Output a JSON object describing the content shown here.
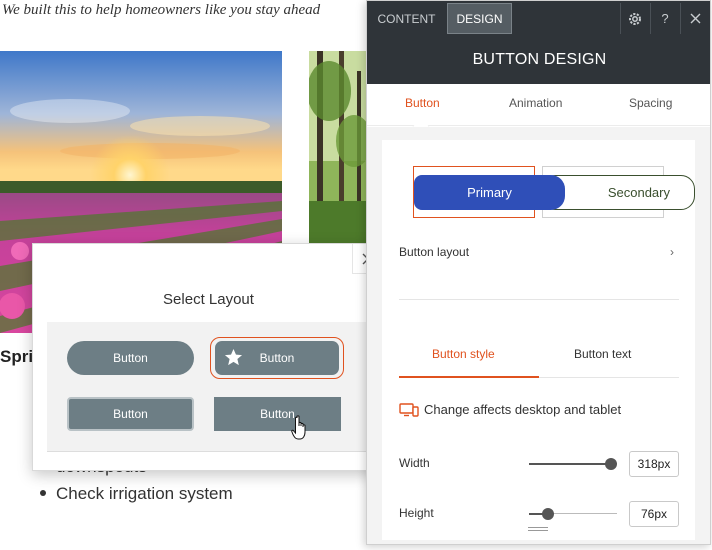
{
  "background": {
    "intro_text": "We built this to help homeowners like you stay ahead",
    "card_title": "Spri",
    "bullet_wrapped": "downspouts",
    "bullet_item": "Check irrigation system"
  },
  "layout_popup": {
    "title": "Select Layout",
    "options": [
      {
        "label": "Button",
        "style": "pill"
      },
      {
        "label": "Button",
        "style": "icon-star",
        "selected": true
      },
      {
        "label": "Button",
        "style": "bordered"
      },
      {
        "label": "Button",
        "style": "square",
        "hovered": true
      }
    ]
  },
  "panel": {
    "top_tabs": {
      "content": "CONTENT",
      "design": "DESIGN"
    },
    "top_icons": {
      "help": "?"
    },
    "header": "BUTTON DESIGN",
    "sub_tabs": {
      "button": "Button",
      "animation": "Animation",
      "spacing": "Spacing"
    },
    "primary_label": "Primary",
    "secondary_label": "Secondary",
    "button_layout_label": "Button layout",
    "chevron": "›",
    "style_tabs": {
      "style": "Button style",
      "text": "Button text"
    },
    "change_note": "Change affects desktop and tablet",
    "width": {
      "label": "Width",
      "value": "318px",
      "level": 0.9
    },
    "height": {
      "label": "Height",
      "value": "76px",
      "level": 0.18
    }
  },
  "colors": {
    "accent": "#e0521f",
    "primary_button": "#2f4fb8",
    "secondary_border": "#3a4f2e",
    "layout_button": "#6d7e85",
    "topbar": "#2f3439"
  }
}
